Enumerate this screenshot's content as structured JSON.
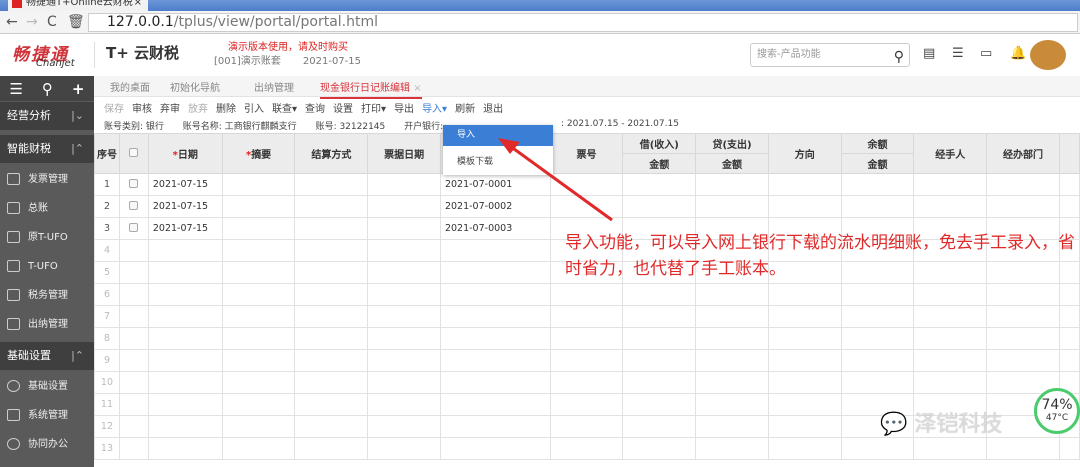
{
  "browser": {
    "tab_title": "畅捷通T+Online云财税",
    "url_host": "127.0.0.1",
    "url_path": "/tplus/view/portal/portal.html"
  },
  "header": {
    "brand": "畅捷通",
    "brand_sub": "Chanjet",
    "product": "T+ 云财税",
    "demo_notice": "演示版本使用，请及时购买",
    "account_set": "[001]演示账套",
    "date": "2021-07-15",
    "search_placeholder": "搜索-产品功能"
  },
  "sidebar": {
    "groups": [
      {
        "label": "经营分析"
      },
      {
        "label": "智能财税"
      },
      {
        "label": "基础设置"
      }
    ],
    "items": [
      {
        "label": "发票管理"
      },
      {
        "label": "总账"
      },
      {
        "label": "原T-UFO"
      },
      {
        "label": "T-UFO"
      },
      {
        "label": "税务管理"
      },
      {
        "label": "出纳管理"
      },
      {
        "label": "基础设置"
      },
      {
        "label": "系统管理"
      },
      {
        "label": "协同办公"
      }
    ]
  },
  "tabs": [
    {
      "label": "我的桌面"
    },
    {
      "label": "初始化导航"
    },
    {
      "label": "出纳管理"
    },
    {
      "label": "现金银行日记账编辑",
      "active": true
    }
  ],
  "toolbar": [
    "保存",
    "审核",
    "弃审",
    "放弃",
    "删除",
    "引入",
    "联查▾",
    "查询",
    "设置",
    "打印▾",
    "导出",
    "导入▾",
    "刷新",
    "退出"
  ],
  "info": {
    "type": "账号类别: 银行",
    "name": "账号名称: 工商银行麒麟支行",
    "number": "账号: 32122145",
    "bank": "开户银行:",
    "period": ": 2021.07.15 - 2021.07.15"
  },
  "dropdown": {
    "items": [
      "导入",
      "模板下载"
    ],
    "active": 0
  },
  "table": {
    "headers": {
      "seq": "序号",
      "date": "日期",
      "summary": "摘要",
      "settle": "结算方式",
      "billdate": "票据日期",
      "billno": "票号",
      "debit": "借(收入)",
      "credit": "贷(支出)",
      "direction": "方向",
      "balance": "余额",
      "amount": "金额",
      "handler": "经手人",
      "dept": "经办部门"
    },
    "rows": [
      {
        "n": "1",
        "date": "2021-07-15",
        "voucher": "2021-07-0001"
      },
      {
        "n": "2",
        "date": "2021-07-15",
        "voucher": "2021-07-0002"
      },
      {
        "n": "3",
        "date": "2021-07-15",
        "voucher": "2021-07-0003"
      }
    ],
    "empty_rows": [
      "4",
      "5",
      "6",
      "7",
      "8",
      "9",
      "10",
      "11",
      "12",
      "13"
    ]
  },
  "annotation": "导入功能，可以导入网上银行下载的流水明细账，免去手工录入，省时省力，也代替了手工账本。",
  "watermark": "泽铠科技",
  "gauge": {
    "percent": "74%",
    "temp": "47°C"
  },
  "colors": {
    "brand_red": "#d0343a",
    "accent_blue": "#3a7fd5",
    "sidebar": "#5a5a5a"
  }
}
